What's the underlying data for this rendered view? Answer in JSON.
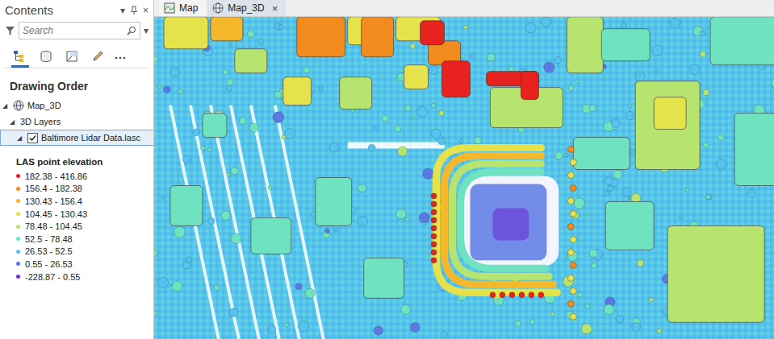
{
  "contents_pane": {
    "title": "Contents",
    "controls": [
      "▾",
      "×"
    ],
    "search": {
      "placeholder": "Search",
      "dropdown": "▾"
    },
    "toolbar": [
      {
        "kind": "drawing-order",
        "selected": true
      },
      {
        "kind": "data-source",
        "selected": false
      },
      {
        "kind": "selection",
        "selected": false
      },
      {
        "kind": "editing",
        "selected": false
      }
    ],
    "more": "...",
    "heading": "Drawing Order",
    "tree": [
      {
        "label": "Map_3D",
        "kind": "scene",
        "toggle": "◢",
        "expanded": true,
        "children": [
          {
            "label": "3D Layers",
            "kind": "group",
            "toggle": "◢",
            "expanded": true,
            "children": [
              {
                "label": "Baltimore Lidar Data.lasc",
                "kind": "layer",
                "toggle": "◢",
                "expanded": true,
                "checked": true,
                "selected": true,
                "children": []
              }
            ]
          }
        ]
      }
    ],
    "legend": {
      "title": "LAS point elevation",
      "classes": [
        {
          "label": "182.38 - 416.86",
          "color": "#e8231f"
        },
        {
          "label": "156.4 - 182.38",
          "color": "#f28c1e"
        },
        {
          "label": "130.43 - 156.4",
          "color": "#f5b82a"
        },
        {
          "label": "104.45 - 130.43",
          "color": "#e6e24b"
        },
        {
          "label": "78.48 - 104.45",
          "color": "#b6e46e"
        },
        {
          "label": "52.5 - 78.48",
          "color": "#6fe3c0"
        },
        {
          "label": "26.53 - 52.5",
          "color": "#55c3f0"
        },
        {
          "label": "0.55 - 26.53",
          "color": "#5b79e3"
        },
        {
          "label": "-228.87 - 0.55",
          "color": "#6a2fd6"
        }
      ]
    }
  },
  "tabs": [
    {
      "label": "Map",
      "kind": "map",
      "selected": false,
      "close": ""
    },
    {
      "label": "Map_3D",
      "kind": "scene",
      "selected": true,
      "close": "×"
    }
  ]
}
